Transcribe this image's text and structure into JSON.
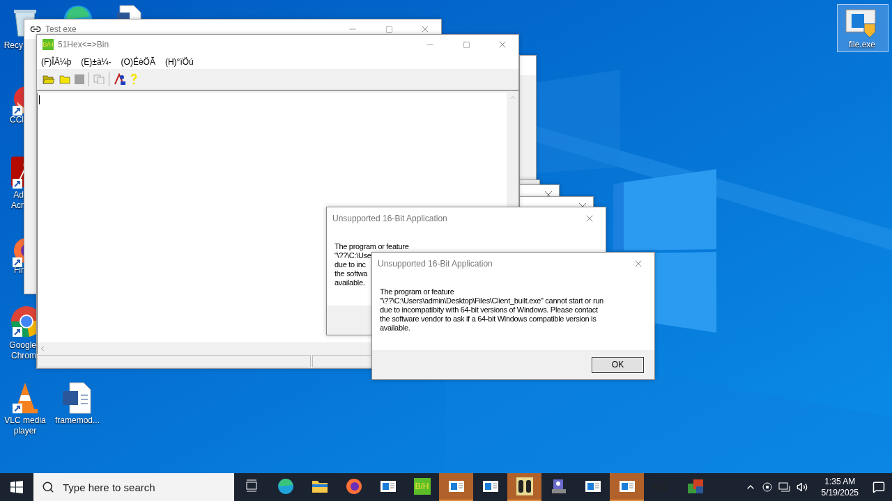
{
  "desktop_icons": [
    {
      "kind": "recycle-bin",
      "label_lines": [
        "Recy"
      ],
      "selected": false
    },
    {
      "kind": "edge",
      "selected": false
    },
    {
      "kind": "document",
      "selected": false
    },
    {
      "kind": "ccleaner",
      "label_lines": [
        "CCl"
      ],
      "selected": false
    },
    {
      "kind": "acrobat",
      "label_lines": [
        "Ad",
        "Acr"
      ],
      "selected": false
    },
    {
      "kind": "firefox",
      "label_lines": [
        "Fir"
      ],
      "selected": false
    },
    {
      "kind": "chrome",
      "label_lines": [
        "Google",
        "Chrom"
      ],
      "selected": false
    },
    {
      "kind": "vlc",
      "label_lines": [
        "VLC media",
        "player"
      ],
      "selected": false
    },
    {
      "kind": "word",
      "label_lines": [
        "framemod..."
      ],
      "selected": false
    },
    {
      "kind": "setup",
      "label_lines": [
        "file.exe"
      ],
      "selected": true
    }
  ],
  "back_window": {
    "title": "Test exe"
  },
  "hex_window": {
    "logo_text": "B/H",
    "title": "51Hex<=>Bin",
    "menu": [
      "(F)ÎÄ¼þ",
      "(E)±à¼-",
      "(O)ÉèÖÃ",
      "(H)°ïÖú"
    ]
  },
  "dialogs": [
    {
      "title": "Unsupported 16-Bit Application",
      "message_lines": [
        "The program or feature",
        "\"\\??\\C:\\Use",
        "due to inc",
        "the softwa",
        "available."
      ]
    },
    {
      "title": "Unsupported 16-Bit Application",
      "message": "The program or feature\n\"\\??\\C:\\Users\\admin\\Desktop\\Files\\Client_built.exe\" cannot start or run\ndue to incompatibity with 64-bit versions of Windows. Please contact\nthe software vendor to ask if a 64-bit Windows compatible version is\navailable.",
      "button": "OK"
    }
  ],
  "taskbar": {
    "search": {
      "placeholder": "Type here to search"
    },
    "apps": [
      {
        "kind": "task-view",
        "flashing": false
      },
      {
        "kind": "edge",
        "flashing": false
      },
      {
        "kind": "explorer",
        "flashing": false
      },
      {
        "kind": "firefox",
        "flashing": false
      },
      {
        "kind": "window",
        "flashing": false
      },
      {
        "kind": "hex",
        "text": "B/H",
        "flashing": false
      },
      {
        "kind": "window",
        "flashing": true
      },
      {
        "kind": "window",
        "flashing": false
      },
      {
        "kind": "binoculars",
        "flashing": true
      },
      {
        "kind": "setup",
        "flashing": false
      },
      {
        "kind": "window",
        "flashing": false
      },
      {
        "kind": "window",
        "flashing": true
      },
      {
        "kind": "link",
        "flashing": false
      },
      {
        "kind": "office",
        "flashing": false
      }
    ],
    "time": "1:35 AM",
    "date": "5/19/2025"
  }
}
